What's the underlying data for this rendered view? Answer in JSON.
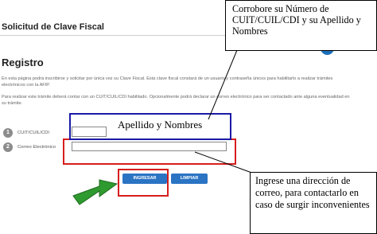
{
  "header": {
    "title": "Solicitud de Clave Fiscal"
  },
  "main": {
    "section_title": "Registro",
    "intro_text": "En esta página podrá inscribirse y solicitar por única vez su Clave Fiscal. Esta clave fiscal constará de un usuario y contraseña únicos para habilitarlo a realizar trámites electrónicos con la AFIP.",
    "cuit_text": "Para realizar este trámite deberá contar con un CUIT/CUIL/CDI habilitado. Opcionalmente podrá declarar un correo electrónico para ser contactado ante alguna eventualidad en su trámite.",
    "info_icon_glyph": "i"
  },
  "form": {
    "steps": [
      {
        "number": "1",
        "label": "CUIT/CUIL/CDI",
        "value": ""
      },
      {
        "number": "2",
        "label": "Correo Electrónico",
        "value": ""
      }
    ],
    "buttons": {
      "submit": "INGRESAR",
      "clear": "LIMPIAR"
    }
  },
  "annotations": {
    "top_callout": "Corrobore su Número de CUIT/CUIL/CDI y su Apellido y Nombres",
    "name_highlight": "Apellido y Nombres",
    "bottom_callout": "Ingrese una dirección de correo, para contactarlo en caso de surgir inconvenientes"
  },
  "colors": {
    "button_blue": "#2b74c4",
    "highlight_red": "#d71d1d",
    "highlight_blue": "#1a1aa6",
    "arrow_green": "#2f9a2f"
  }
}
